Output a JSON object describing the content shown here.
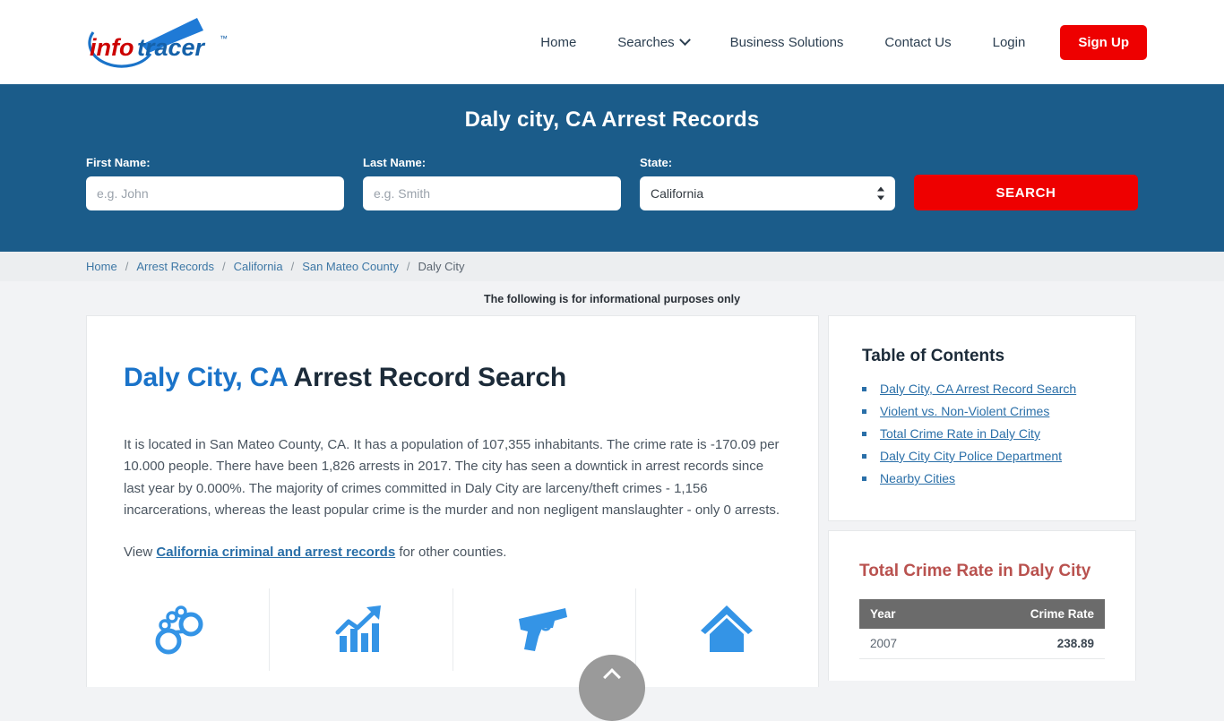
{
  "header": {
    "logo_text": "infotracer",
    "logo_tm": "™",
    "nav": [
      {
        "label": "Home",
        "icon": null
      },
      {
        "label": "Searches",
        "icon": "chevron-down-icon"
      },
      {
        "label": "Business Solutions",
        "icon": null
      },
      {
        "label": "Contact Us",
        "icon": null
      },
      {
        "label": "Login",
        "icon": null
      }
    ],
    "signup_label": "Sign Up"
  },
  "hero": {
    "title": "Daly city, CA Arrest Records",
    "first_name_label": "First Name:",
    "first_name_placeholder": "e.g. John",
    "first_name_value": "",
    "last_name_label": "Last Name:",
    "last_name_placeholder": "e.g. Smith",
    "last_name_value": "",
    "state_label": "State:",
    "state_value": "California",
    "state_options": [
      "California"
    ],
    "search_label": "SEARCH",
    "bg_color": "#1b5c8a",
    "button_color": "#ee0000"
  },
  "breadcrumb": {
    "items": [
      "Home",
      "Arrest Records",
      "California",
      "San Mateo County",
      "Daly City"
    ],
    "separator": "/"
  },
  "disclaimer": "The following is for informational purposes only",
  "main": {
    "heading_highlight": "Daly City, CA",
    "heading_rest": " Arrest Record Search",
    "paragraph": "It is located in San Mateo County, CA. It has a population of 107,355 inhabitants. The crime rate is -170.09 per 10.000 people. There have been 1,826 arrests in 2017. The city has seen a downtick in arrest records since last year by 0.000%. The majority of crimes committed in Daly City are larceny/theft crimes - 1,156 incarcerations, whereas the least popular crime is the murder and non negligent manslaughter - only 0 arrests.",
    "view_prefix": "View ",
    "view_link": "California criminal and arrest records",
    "view_suffix": " for other counties.",
    "icons": [
      {
        "name": "handcuffs-icon"
      },
      {
        "name": "crime-trend-chart-icon"
      },
      {
        "name": "handgun-icon"
      },
      {
        "name": "house-icon"
      }
    ]
  },
  "sidebar": {
    "toc_title": "Table of Contents",
    "toc_items": [
      "Daly City, CA Arrest Record Search",
      "Violent vs. Non-Violent Crimes",
      "Total Crime Rate in Daly City",
      "Daly City City Police Department",
      "Nearby Cities"
    ],
    "crime_title": "Total Crime Rate in Daly City",
    "crime_table": {
      "columns": [
        "Year",
        "Crime Rate"
      ],
      "rows": [
        {
          "year": "2007",
          "rate": "238.89"
        }
      ]
    }
  },
  "scroll_top": {
    "name": "scroll-to-top-button",
    "icon": "chevron-up-icon"
  },
  "chart_data": {
    "type": "table",
    "title": "Total Crime Rate in Daly City",
    "columns": [
      "Year",
      "Crime Rate"
    ],
    "rows": [
      [
        "2007",
        238.89
      ]
    ]
  }
}
